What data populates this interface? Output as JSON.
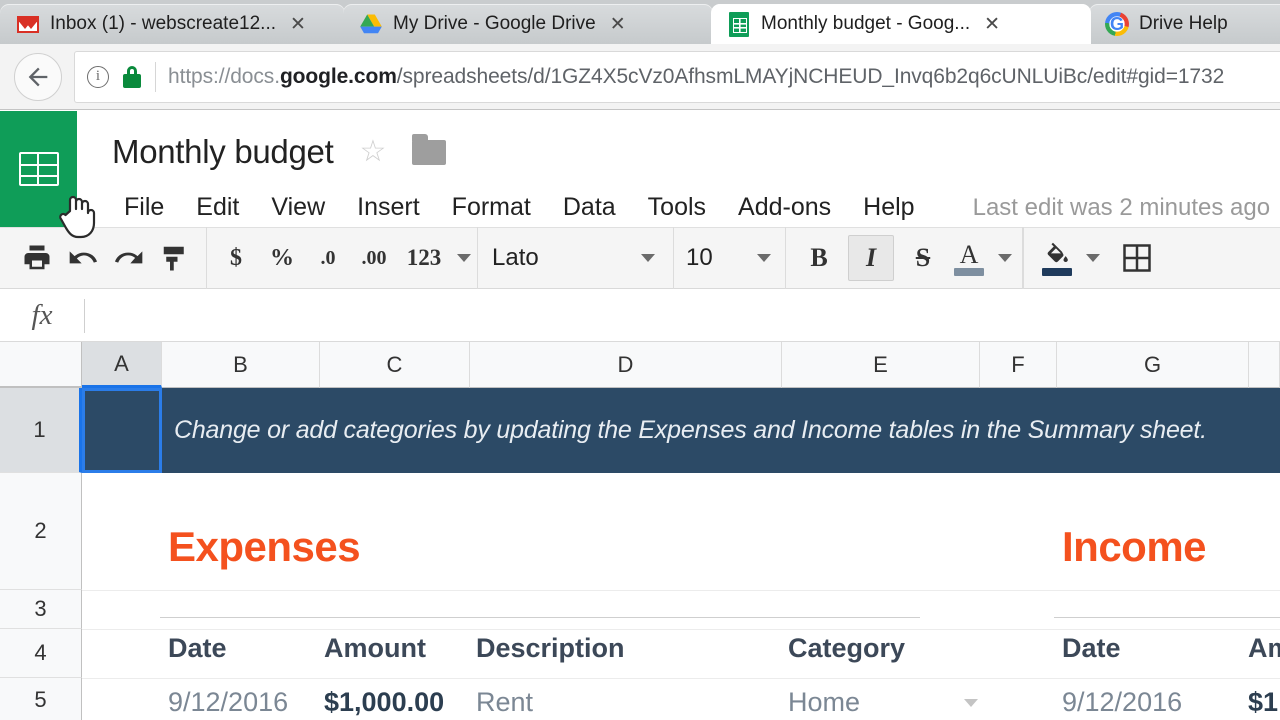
{
  "browser": {
    "tabs": [
      {
        "title": "Inbox (1) - webscreate12...",
        "favicon": "gmail-icon",
        "active": false,
        "close_label": "✕"
      },
      {
        "title": "My Drive - Google Drive",
        "favicon": "google-drive-icon",
        "active": false,
        "close_label": "✕"
      },
      {
        "title": "Monthly budget - Goog...",
        "favicon": "google-sheets-icon",
        "active": true,
        "close_label": "✕"
      },
      {
        "title": "Drive Help",
        "favicon": "google-icon",
        "active": false,
        "close_label": "✕"
      }
    ],
    "omnibox": {
      "scheme": "https://docs.",
      "domain": "google.com",
      "path": "/spreadsheets/d/1GZ4X5cVz0AfhsmLMAYjNCHEUD_Invq6b2q6cUNLUiBc/edit#gid=1732",
      "security": "secure-lock-icon",
      "info": "page-info-icon"
    },
    "back_button": "back-arrow-icon"
  },
  "sheets": {
    "logo": "google-sheets-logo",
    "doc_title": "Monthly budget",
    "star": "☆",
    "folder": "move-to-folder-icon",
    "menus": [
      "File",
      "Edit",
      "View",
      "Insert",
      "Format",
      "Data",
      "Tools",
      "Add-ons",
      "Help"
    ],
    "last_edit": "Last edit was 2 minutes ago",
    "toolbar": {
      "print": "print-icon",
      "undo": "undo-icon",
      "redo": "redo-icon",
      "paint_format": "paint-format-icon",
      "currency": "$",
      "percent": "%",
      "decrease_decimal": ".0",
      "increase_decimal": ".00",
      "more_formats": "123",
      "font_family": "Lato",
      "font_size": "10",
      "bold": "B",
      "italic": "I",
      "strikethrough": "S",
      "text_color": "A",
      "text_color_swatch": "#7e8fa0",
      "fill_color": "fill-color-icon",
      "fill_color_swatch": "#1f3b5c",
      "borders": "borders-icon",
      "italic_active": true
    },
    "formula_bar": {
      "fx_label": "fx",
      "value": ""
    },
    "grid": {
      "columns": [
        "A",
        "B",
        "C",
        "D",
        "E",
        "F",
        "G"
      ],
      "selected_column": "A",
      "rows": [
        "1",
        "2",
        "3",
        "4",
        "5"
      ],
      "selected_row": "1",
      "active_cell": "A1",
      "banner_text": "Change or add categories by updating the Expenses and Income tables in the Summary sheet.",
      "banner_bg": "#2c4a66",
      "accent_color": "#f4511e"
    },
    "expenses": {
      "title": "Expenses",
      "headers": [
        "Date",
        "Amount",
        "Description",
        "Category"
      ],
      "rows": [
        {
          "date": "9/12/2016",
          "amount": "$1,000.00",
          "description": "Rent",
          "category": "Home"
        }
      ]
    },
    "income": {
      "title": "Income",
      "headers": [
        "Date",
        "Amount"
      ],
      "rows": [
        {
          "date": "9/12/2016",
          "amount": "$1"
        }
      ]
    }
  }
}
